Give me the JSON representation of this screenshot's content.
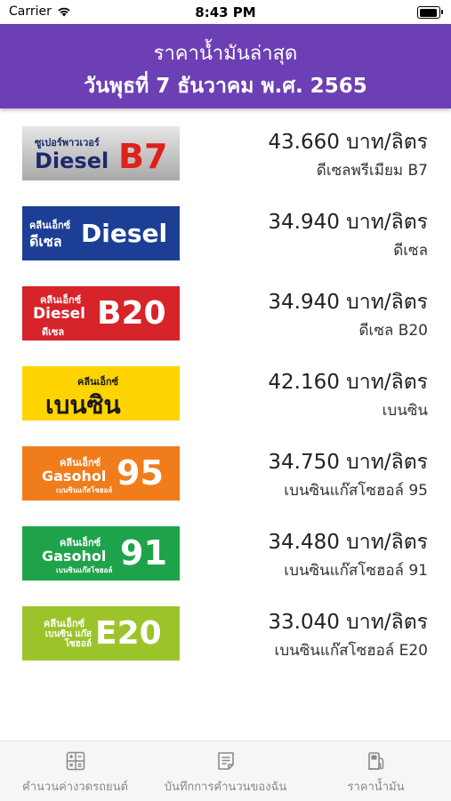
{
  "status_bar": {
    "carrier": "Carrier",
    "time": "8:43 PM"
  },
  "header": {
    "title": "ราคาน้ำมันล่าสุด",
    "date": "วันพุธที่ 7 ธันวาคม พ.ศ. 2565"
  },
  "fuels": [
    {
      "logo_small": "ซูเปอร์พาวเวอร์",
      "logo_main": "Diesel",
      "logo_suffix": "B7",
      "logo_sub": "",
      "price": "43.660 บาท/ลิตร",
      "name": "ดีเซลพรีเมียม B7",
      "colors": {
        "bg": "#c9c9c9",
        "text": "#1c2a6b",
        "accent": "#e0201b"
      }
    },
    {
      "logo_small": "คลีนเอ็กซ์",
      "logo_main": "ดีเซล",
      "logo_suffix": "Diesel",
      "logo_sub": "",
      "price": "34.940 บาท/ลิตร",
      "name": "ดีเซล",
      "colors": {
        "bg": "#1c3f95",
        "text": "#ffffff",
        "accent": "#ffffff"
      }
    },
    {
      "logo_small": "คลีนเอ็กซ์",
      "logo_main": "Diesel",
      "logo_suffix": "B20",
      "logo_sub": "ดีเซล",
      "price": "34.940 บาท/ลิตร",
      "name": "ดีเซล B20",
      "colors": {
        "bg": "#d7232a",
        "text": "#ffffff",
        "accent": "#ffffff"
      }
    },
    {
      "logo_small": "คลีนเอ็กซ์",
      "logo_main": "เบนซิน",
      "logo_suffix": "",
      "logo_sub": "",
      "price": "42.160 บาท/ลิตร",
      "name": "เบนซิน",
      "colors": {
        "bg": "#ffd400",
        "text": "#1a1a1a",
        "accent": "#1a1a1a"
      }
    },
    {
      "logo_small": "คลีนเอ็กซ์",
      "logo_main": "Gasohol",
      "logo_suffix": "95",
      "logo_sub": "เบนซินแก๊สโซฮอล์",
      "price": "34.750 บาท/ลิตร",
      "name": "เบนซินแก๊สโซฮอล์ 95",
      "colors": {
        "bg": "#f07c1b",
        "text": "#ffffff",
        "accent": "#ffffff"
      }
    },
    {
      "logo_small": "คลีนเอ็กซ์",
      "logo_main": "Gasohol",
      "logo_suffix": "91",
      "logo_sub": "เบนซินแก๊สโซฮอล์",
      "price": "34.480 บาท/ลิตร",
      "name": "เบนซินแก๊สโซฮอล์ 91",
      "colors": {
        "bg": "#1fa34a",
        "text": "#ffffff",
        "accent": "#ffffff"
      }
    },
    {
      "logo_small": "คลีนเอ็กซ์",
      "logo_main": "เบนซิน แก๊สโซฮอล์",
      "logo_suffix": "E20",
      "logo_sub": "",
      "price": "33.040 บาท/ลิตร",
      "name": "เบนซินแก๊สโซฮอล์ E20",
      "colors": {
        "bg": "#9cc42a",
        "text": "#ffffff",
        "accent": "#ffffff"
      }
    }
  ],
  "tabs": [
    {
      "label": "คำนวนค่างวดรถยนต์",
      "icon": "calculator-icon"
    },
    {
      "label": "บันทึกการคำนวนของฉัน",
      "icon": "notes-icon"
    },
    {
      "label": "ราคาน้ำมัน",
      "icon": "fuel-pump-icon"
    }
  ],
  "theme": {
    "header_bg": "#6c3fb5",
    "tab_inactive": "#8a8a8a"
  }
}
